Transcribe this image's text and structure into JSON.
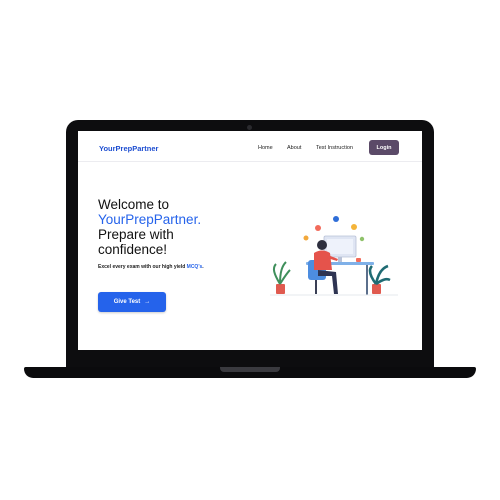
{
  "brand": "YourPrepPartner",
  "nav": {
    "links": [
      "Home",
      "About",
      "Test Instruction"
    ],
    "login_label": "Login"
  },
  "hero": {
    "title_line1": "Welcome to",
    "title_accent": "YourPrepPartner.",
    "title_line3": "Prepare with",
    "title_line4": "confidence!",
    "subtitle_prefix": "Excel every exam with our high yield ",
    "subtitle_highlight": "MCQ's",
    "subtitle_suffix": ".",
    "cta_label": "Give Test",
    "cta_icon": "→"
  },
  "colors": {
    "brand": "#1f4fd1",
    "accent": "#2563eb",
    "login_button": "#5b4a68"
  }
}
